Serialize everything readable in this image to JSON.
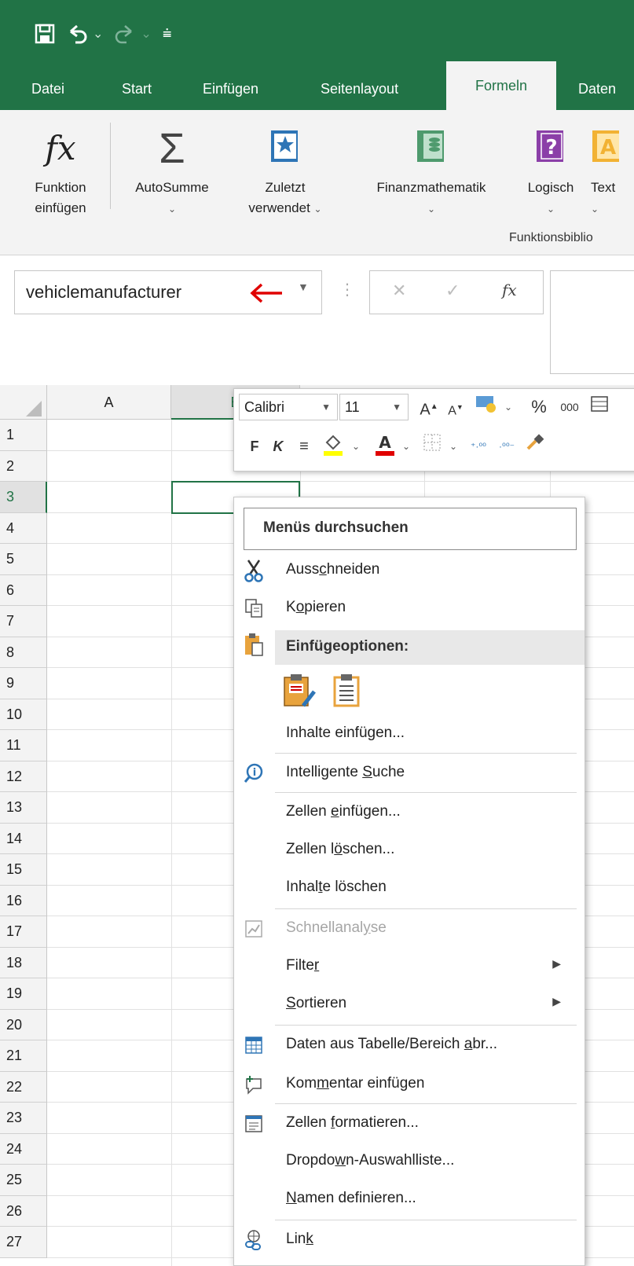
{
  "quick_access": {
    "icons": [
      "save-icon",
      "undo-icon",
      "redo-icon",
      "customize-icon"
    ]
  },
  "tabs": [
    {
      "label": "Datei",
      "active": false
    },
    {
      "label": "Start",
      "active": false
    },
    {
      "label": "Einfügen",
      "active": false
    },
    {
      "label": "Seitenlayout",
      "active": false
    },
    {
      "label": "Formeln",
      "active": true
    },
    {
      "label": "Daten",
      "active": false
    }
  ],
  "ribbon": {
    "insert_function": {
      "line1": "Funktion",
      "line2": "einfügen",
      "icon_text": "fx"
    },
    "autosum": {
      "label": "AutoSumme",
      "icon_text": "Σ"
    },
    "recently_used": {
      "line1": "Zuletzt",
      "line2": "verwendet"
    },
    "financial": {
      "label": "Finanzmathematik"
    },
    "logical": {
      "label": "Logisch"
    },
    "text": {
      "label": "Text"
    },
    "group_label": "Funktionsbiblio"
  },
  "formula_bar": {
    "name_box": "vehiclemanufacturer",
    "cancel_glyph": "✕",
    "enter_glyph": "✓",
    "fx_glyph": "fx",
    "value": ""
  },
  "grid": {
    "columns": [
      "A",
      "B"
    ],
    "rows": [
      "1",
      "2",
      "3",
      "4",
      "5",
      "6",
      "7",
      "8",
      "9",
      "10",
      "11",
      "12",
      "13",
      "14",
      "15",
      "16",
      "17",
      "18",
      "19",
      "20",
      "21",
      "22",
      "23",
      "24",
      "25",
      "26",
      "27"
    ],
    "selected_row": "3"
  },
  "mini_toolbar": {
    "font": "Calibri",
    "size": "11",
    "bold": "F",
    "italic": "K",
    "percent": "%",
    "thousands": "000",
    "colors": {
      "highlight": "#ffff00",
      "font_color": "#e00000"
    }
  },
  "context_menu": {
    "search": "Menüs durchsuchen",
    "items": {
      "cut": {
        "pre": "Auss",
        "u": "c",
        "post": "hneiden"
      },
      "copy": {
        "pre": "K",
        "u": "o",
        "post": "pieren"
      },
      "paste_header": "Einfügeoptionen:",
      "paste_special": {
        "pre": "Inhalte einfügen",
        "u": "",
        "post": "..."
      },
      "smart_lookup": {
        "pre": "Intelligente ",
        "u": "S",
        "post": "uche"
      },
      "insert_cells": {
        "pre": "Zellen ",
        "u": "e",
        "post": "infügen..."
      },
      "delete_cells": {
        "pre": "Zellen l",
        "u": "ö",
        "post": "schen..."
      },
      "clear_contents": {
        "pre": "Inhal",
        "u": "t",
        "post": "e löschen"
      },
      "quick_analysis": {
        "pre": "Schnellanal",
        "u": "y",
        "post": "se"
      },
      "filter": {
        "pre": "Filte",
        "u": "r",
        "post": ""
      },
      "sort": {
        "pre": "",
        "u": "S",
        "post": "ortieren"
      },
      "get_data": {
        "pre": "Daten aus Tabelle/Bereich ",
        "u": "a",
        "post": "br..."
      },
      "insert_comment": {
        "pre": "Kom",
        "u": "m",
        "post": "entar einfügen"
      },
      "format_cells": {
        "pre": "Zellen ",
        "u": "f",
        "post": "ormatieren..."
      },
      "dropdown_list": {
        "pre": "Dropdo",
        "u": "w",
        "post": "n-Auswahlliste..."
      },
      "define_name": {
        "pre": "",
        "u": "N",
        "post": "amen definieren..."
      },
      "link": {
        "pre": "Lin",
        "u": "k",
        "post": ""
      }
    }
  },
  "colors": {
    "excel_green": "#217346",
    "red_arrow": "#e00000"
  }
}
